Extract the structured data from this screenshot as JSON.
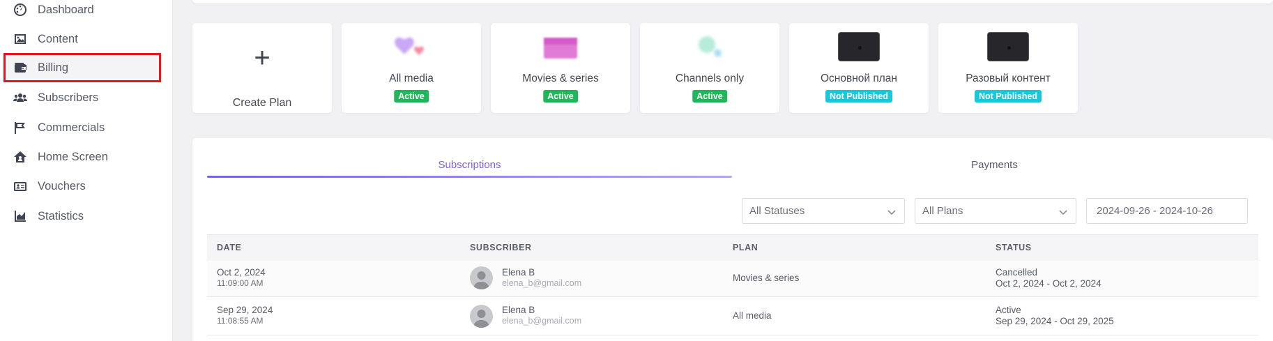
{
  "sidebar": {
    "items": [
      {
        "label": "Dashboard",
        "icon": "dashboard-icon"
      },
      {
        "label": "Content",
        "icon": "image-icon"
      },
      {
        "label": "Billing",
        "icon": "wallet-icon"
      },
      {
        "label": "Subscribers",
        "icon": "users-icon"
      },
      {
        "label": "Commercials",
        "icon": "flag-icon"
      },
      {
        "label": "Home Screen",
        "icon": "home-icon"
      },
      {
        "label": "Vouchers",
        "icon": "id-card-icon"
      },
      {
        "label": "Statistics",
        "icon": "chart-area-icon"
      }
    ],
    "highlighted": "Billing",
    "highlight_color": "#e3161c"
  },
  "plans": {
    "create_label": "Create Plan",
    "cards": [
      {
        "name": "All media",
        "status": "Active"
      },
      {
        "name": "Movies & series",
        "status": "Active"
      },
      {
        "name": "Channels only",
        "status": "Active"
      },
      {
        "name": "Основной план",
        "status": "Not Published"
      },
      {
        "name": "Разовый контент",
        "status": "Not Published"
      }
    ],
    "active_color": "#22b55b",
    "unpublished_color": "#19c7d9"
  },
  "tabs": {
    "subscriptions": "Subscriptions",
    "payments": "Payments",
    "accent_color": "#7b62d9"
  },
  "filters": {
    "status": "All Statuses",
    "plan": "All Plans",
    "date_range": "2024-09-26 - 2024-10-26"
  },
  "table": {
    "headers": [
      "DATE",
      "SUBSCRIBER",
      "PLAN",
      "STATUS"
    ],
    "rows": [
      {
        "date": "Oct 2, 2024",
        "time": "11:09:00 AM",
        "name": "Elena B",
        "email": "elena_b@gmail.com",
        "plan": "Movies & series",
        "status": "Cancelled",
        "period": "Oct 2, 2024 - Oct 2, 2024"
      },
      {
        "date": "Sep 29, 2024",
        "time": "11:08:55 AM",
        "name": "Elena B",
        "email": "elena_b@gmail.com",
        "plan": "All media",
        "status": "Active",
        "period": "Sep 29, 2024 - Oct 29, 2025"
      }
    ]
  }
}
